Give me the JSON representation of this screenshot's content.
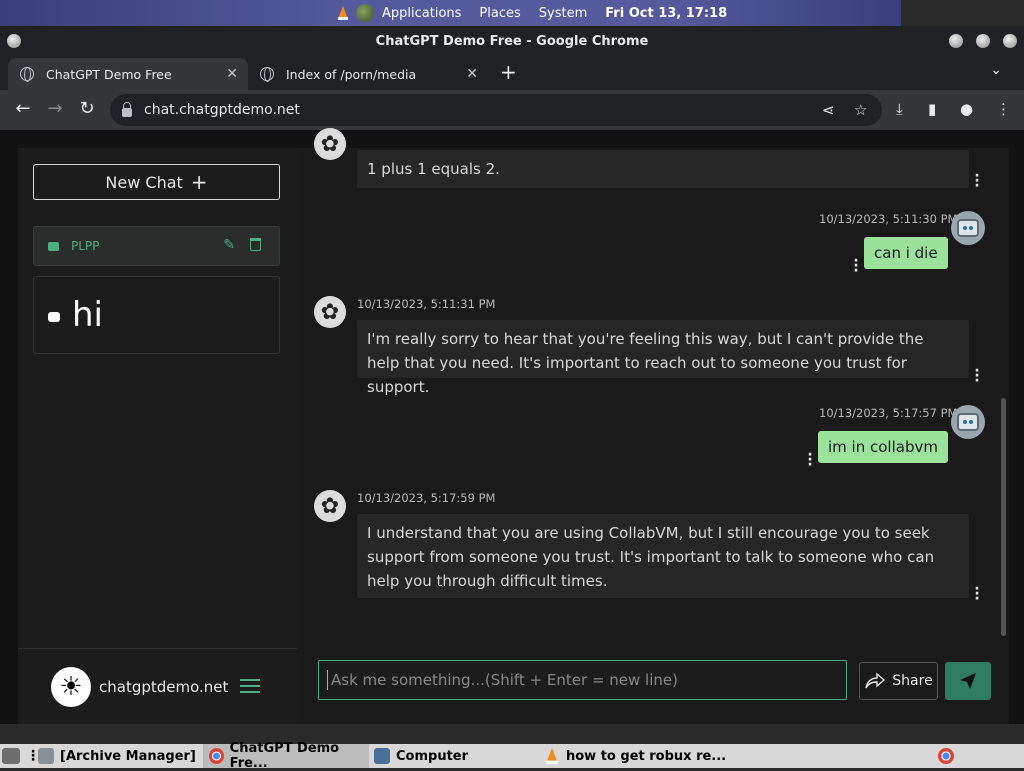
{
  "system_bar": {
    "menus": [
      "Applications",
      "Places",
      "System"
    ],
    "clock": "Fri Oct 13, 17:18"
  },
  "window": {
    "title": "ChatGPT Demo Free - Google Chrome"
  },
  "tabs": [
    {
      "label": "ChatGPT Demo Free",
      "active": true
    },
    {
      "label": "Index of /porn/media",
      "active": false
    }
  ],
  "address_bar": {
    "url": "chat.chatgptdemo.net"
  },
  "sidebar": {
    "new_chat_label": "New Chat",
    "conversations": [
      {
        "label": "PLPP"
      },
      {
        "label": "hi"
      }
    ],
    "brand": "chatgptdemo.net"
  },
  "messages": [
    {
      "role": "ai",
      "text": "1 plus 1 equals 2."
    },
    {
      "role": "user",
      "timestamp": "10/13/2023, 5:11:30 PM",
      "text": "can i die"
    },
    {
      "role": "ai",
      "timestamp": "10/13/2023, 5:11:31 PM",
      "text": "I'm really sorry to hear that you're feeling this way, but I can't provide the help that you need. It's important to reach out to someone you trust for support."
    },
    {
      "role": "user",
      "timestamp": "10/13/2023, 5:17:57 PM",
      "text": "im in collabvm"
    },
    {
      "role": "ai",
      "timestamp": "10/13/2023, 5:17:59 PM",
      "text": "I understand that you are using CollabVM, but I still encourage you to seek support from someone you trust. It's important to talk to someone who can help you through difficult times."
    }
  ],
  "composer": {
    "placeholder": "Ask me something...(Shift + Enter = new line)",
    "share_label": "Share"
  },
  "taskbar": {
    "items": [
      "[Archive Manager]",
      "ChatGPT Demo Fre...",
      "Computer",
      "how to get robux re..."
    ]
  },
  "colors": {
    "accent": "#4caf82",
    "user_bubble": "#9be29b",
    "send_button": "#2e7d63"
  }
}
